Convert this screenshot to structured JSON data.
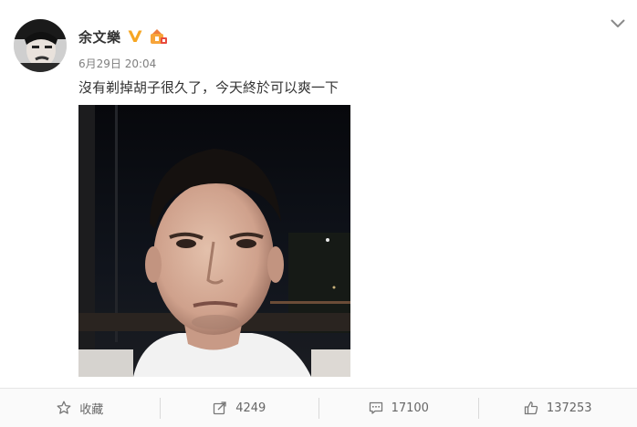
{
  "post": {
    "author_name": "余文樂",
    "verified_icon": "verified-v-icon",
    "badge_icon": "member-badge-icon",
    "timestamp": "6月29日 20:04",
    "text": "沒有剃掉胡子很久了，今天終於可以爽一下",
    "expand_icon": "chevron-down-icon"
  },
  "actions": {
    "favorite": {
      "icon": "star-icon",
      "label": "收藏"
    },
    "repost": {
      "icon": "share-icon",
      "count": "4249"
    },
    "comment": {
      "icon": "comment-icon",
      "count": "17100"
    },
    "like": {
      "icon": "thumbs-up-icon",
      "count": "137253"
    }
  },
  "colors": {
    "name_text": "#333333",
    "meta_text": "#808080",
    "verified": "#f6a623",
    "action_text": "#666666",
    "action_bar_bg": "#fafafa"
  }
}
